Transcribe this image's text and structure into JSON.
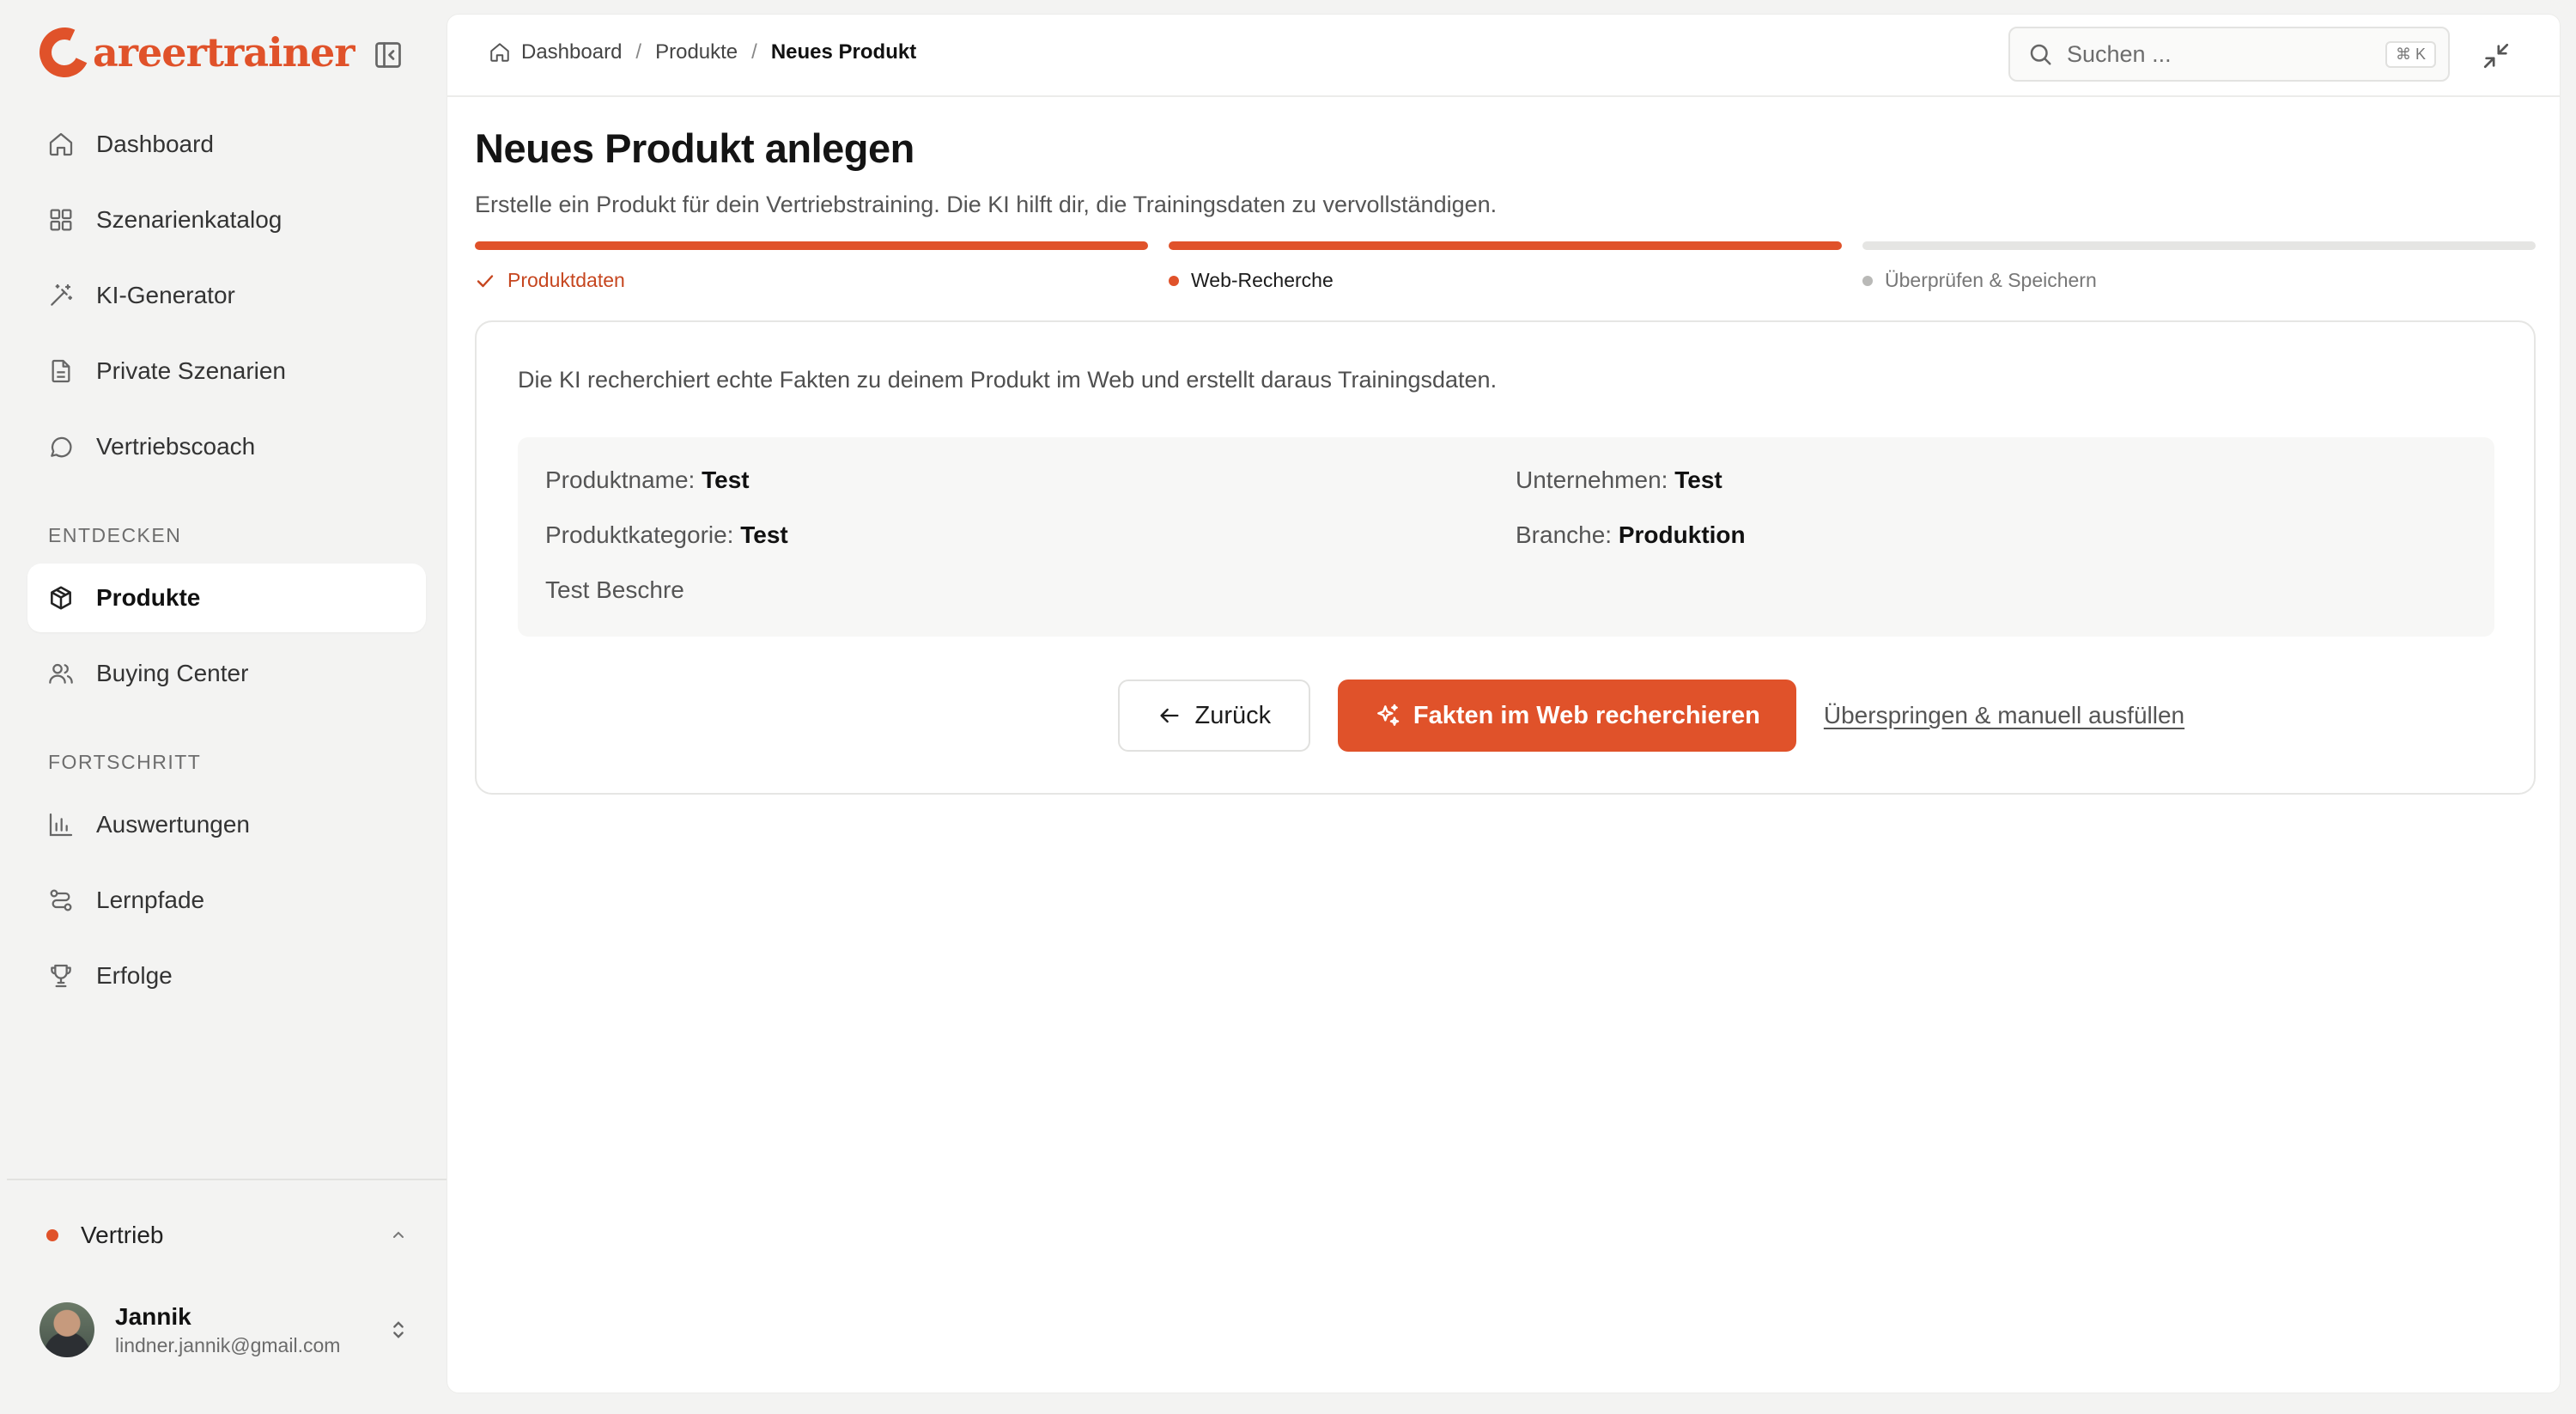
{
  "app": {
    "logo_text": "areertrainer",
    "brand_color": "#e0522a"
  },
  "sidebar": {
    "items": [
      {
        "label": "Dashboard",
        "icon": "home-icon"
      },
      {
        "label": "Szenarienkatalog",
        "icon": "grid-icon"
      },
      {
        "label": "KI-Generator",
        "icon": "magic-wand-icon"
      },
      {
        "label": "Private Szenarien",
        "icon": "document-icon"
      },
      {
        "label": "Vertriebscoach",
        "icon": "chat-bubble-icon"
      }
    ],
    "section_discover": "ENTDECKEN",
    "discover_items": [
      {
        "label": "Produkte",
        "icon": "package-icon",
        "active": true
      },
      {
        "label": "Buying Center",
        "icon": "users-icon"
      }
    ],
    "section_progress": "FORTSCHRITT",
    "progress_items": [
      {
        "label": "Auswertungen",
        "icon": "bar-chart-icon"
      },
      {
        "label": "Lernpfade",
        "icon": "route-icon"
      },
      {
        "label": "Erfolge",
        "icon": "trophy-icon"
      }
    ],
    "workspace": {
      "label": "Vertrieb",
      "status_color": "#e0522a"
    },
    "user": {
      "name": "Jannik",
      "email": "lindner.jannik@gmail.com"
    }
  },
  "header": {
    "breadcrumb": [
      "Dashboard",
      "Produkte",
      "Neues Produkt"
    ],
    "search_placeholder": "Suchen ...",
    "search_shortcut": "⌘ K"
  },
  "main": {
    "title": "Neues Produkt anlegen",
    "subtitle": "Erstelle ein Produkt für dein Vertriebstraining. Die KI hilft dir, die Trainingsdaten zu vervollständigen.",
    "steps": [
      {
        "label": "Produktdaten",
        "state": "done"
      },
      {
        "label": "Web-Recherche",
        "state": "current"
      },
      {
        "label": "Überprüfen & Speichern",
        "state": "upcoming"
      }
    ],
    "card": {
      "intro": "Die KI recherchiert echte Fakten zu deinem Produkt im Web und erstellt daraus Trainingsdaten.",
      "facts": {
        "product_name_label": "Produktname:",
        "product_name": "Test",
        "company_label": "Unternehmen:",
        "company": "Test",
        "category_label": "Produktkategorie:",
        "category": "Test",
        "industry_label": "Branche:",
        "industry": "Produktion",
        "description": "Test Beschre"
      },
      "back_label": "Zurück",
      "research_label": "Fakten im Web recherchieren",
      "skip_label": "Überspringen & manuell ausfüllen"
    }
  }
}
